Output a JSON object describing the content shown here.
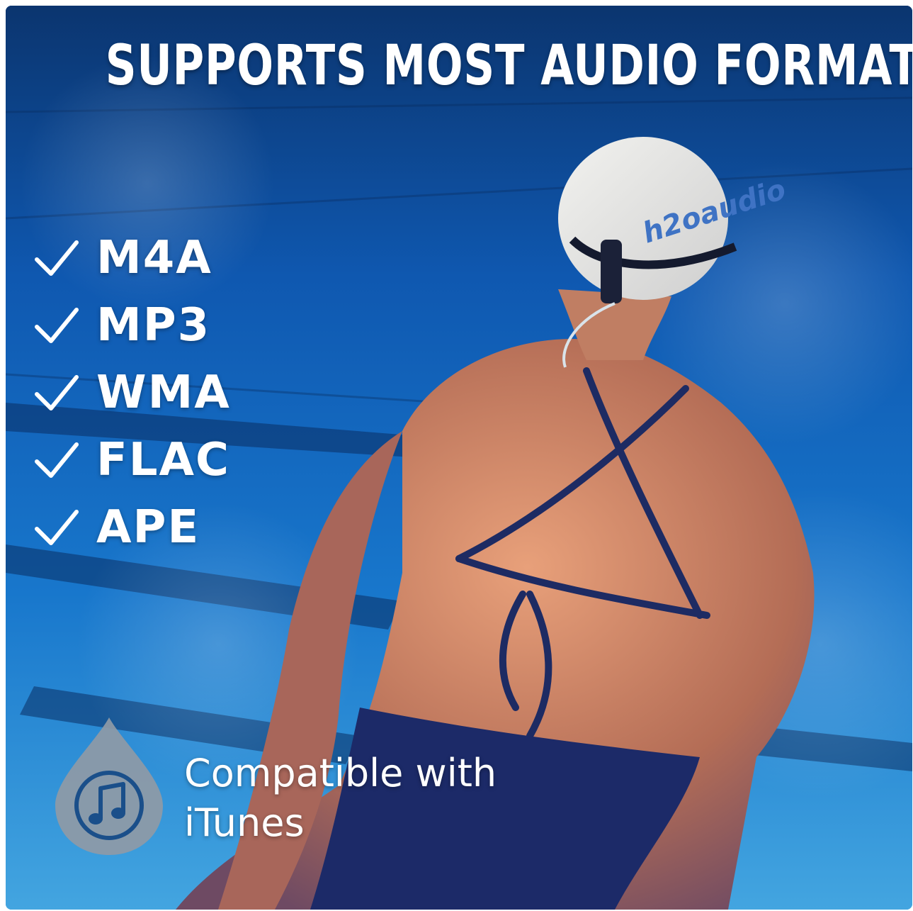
{
  "headline": "SUPPORTS MOST AUDIO FORMATS",
  "formats": [
    "M4A",
    "MP3",
    "WMA",
    "FLAC",
    "APE"
  ],
  "compatibility": {
    "line1": "Compatible with",
    "line2": "iTunes",
    "icon": "music-note-drop-icon"
  },
  "cap_logo_text": "h2oaudio",
  "colors": {
    "text": "#ffffff",
    "badge": "#8f9aa6",
    "badge_icon": "#1a4f8a",
    "water_dark": "#0d3d86",
    "water_light": "#3a9ddd"
  }
}
